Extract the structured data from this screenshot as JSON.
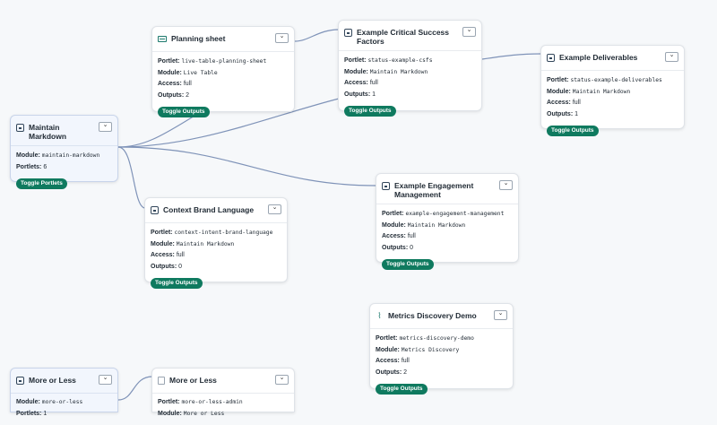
{
  "nodes": {
    "maintain_markdown": {
      "title": "Maintain Markdown",
      "module_label": "Module:",
      "module": "maintain-markdown",
      "portlets_label": "Portlets:",
      "portlets": "6",
      "toggle": "Toggle Portlets",
      "dd": "⌄"
    },
    "planning_sheet": {
      "title": "Planning sheet",
      "portlet_label": "Portlet:",
      "portlet": "live-table-planning-sheet",
      "module_label": "Module:",
      "module": "Live Table",
      "access_label": "Access:",
      "access": "full",
      "outputs_label": "Outputs:",
      "outputs": "2",
      "toggle": "Toggle Outputs",
      "dd": "⌄"
    },
    "csf": {
      "title": "Example Critical Success Factors",
      "portlet_label": "Portlet:",
      "portlet": "status-example-csfs",
      "module_label": "Module:",
      "module": "Maintain Markdown",
      "access_label": "Access:",
      "access": "full",
      "outputs_label": "Outputs:",
      "outputs": "1",
      "toggle": "Toggle Outputs",
      "dd": "⌄"
    },
    "deliverables": {
      "title": "Example Deliverables",
      "portlet_label": "Portlet:",
      "portlet": "status-example-deliverables",
      "module_label": "Module:",
      "module": "Maintain Markdown",
      "access_label": "Access:",
      "access": "full",
      "outputs_label": "Outputs:",
      "outputs": "1",
      "toggle": "Toggle Outputs",
      "dd": "⌄"
    },
    "context_brand": {
      "title": "Context Brand Language",
      "portlet_label": "Portlet:",
      "portlet": "context-intent-brand-language",
      "module_label": "Module:",
      "module": "Maintain Markdown",
      "access_label": "Access:",
      "access": "full",
      "outputs_label": "Outputs:",
      "outputs": "0",
      "toggle": "Toggle Outputs",
      "dd": "⌄"
    },
    "engagement": {
      "title": "Example Engagement Management",
      "portlet_label": "Portlet:",
      "portlet": "example-engagement-management",
      "module_label": "Module:",
      "module": "Maintain Markdown",
      "access_label": "Access:",
      "access": "full",
      "outputs_label": "Outputs:",
      "outputs": "0",
      "toggle": "Toggle Outputs",
      "dd": "⌄"
    },
    "metrics": {
      "title": "Metrics Discovery Demo",
      "portlet_label": "Portlet:",
      "portlet": "metrics-discovery-demo",
      "module_label": "Module:",
      "module": "Metrics Discovery",
      "access_label": "Access:",
      "access": "full",
      "outputs_label": "Outputs:",
      "outputs": "2",
      "toggle": "Toggle Outputs",
      "dd": "⌄"
    },
    "more_or_less_module": {
      "title": "More or Less",
      "module_label": "Module:",
      "module": "more-or-less",
      "portlets_label": "Portlets:",
      "portlets": "1",
      "dd": "⌄"
    },
    "more_or_less_portlet": {
      "title": "More or Less",
      "portlet_label": "Portlet:",
      "portlet": "more-or-less-admin",
      "module_label": "Module:",
      "module": "More or Less",
      "dd": "⌄"
    }
  },
  "colors": {
    "edge": "#7f93b8",
    "toggle": "#0f7a5f",
    "module_node_bg": "#f2f6fd"
  },
  "icons": {
    "module": "document-icon",
    "live_table": "table-icon",
    "metrics": "chart-icon",
    "generic": "page-icon"
  }
}
